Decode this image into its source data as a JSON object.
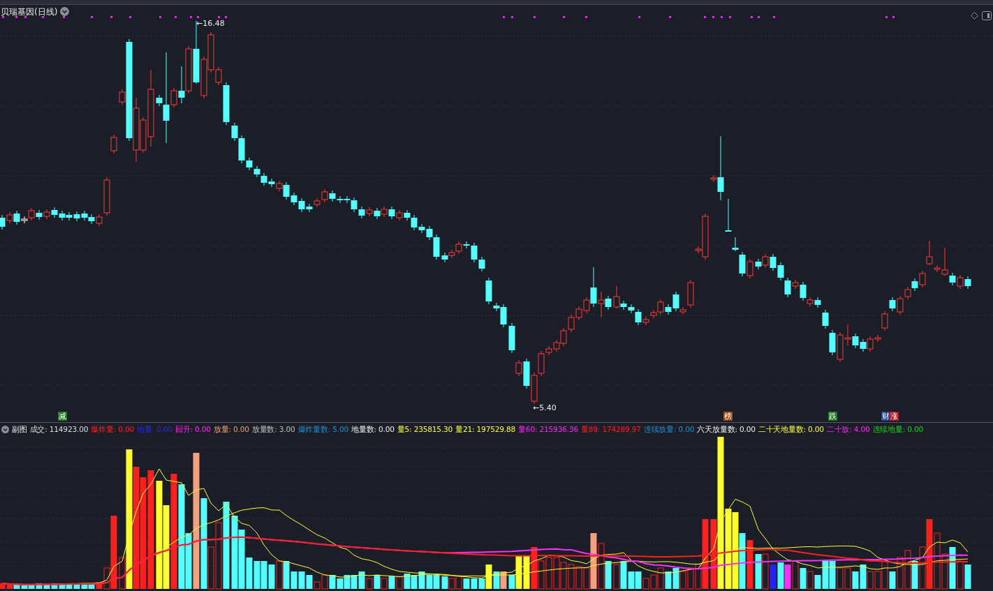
{
  "chart_title": "贝瑞基因(日线)",
  "price_labels": [
    {
      "kind": "high",
      "text": "←16.48"
    },
    {
      "kind": "low",
      "text": "←5.40"
    }
  ],
  "signals": [
    {
      "text": "减",
      "color": "#1d7a22"
    },
    {
      "text": "榜",
      "color": "#9a4e16"
    },
    {
      "text": "跌",
      "color": "#1d7a22"
    },
    {
      "text": "财",
      "color": "#24419c"
    },
    {
      "text": "涨",
      "color": "#b3161b"
    }
  ],
  "subchart": {
    "name": "副图",
    "legend": [
      {
        "text": "成交: 114923.00",
        "color": "#dcdcdc"
      },
      {
        "text": "爆炸量: 0.00",
        "color": "#ff2020"
      },
      {
        "text": "地量: 0.00",
        "color": "#2626ff"
      },
      {
        "text": "回升: 0.00",
        "color": "#ff26ff"
      },
      {
        "text": "放量: 0.00",
        "color": "#f0a070"
      },
      {
        "text": "放量数: 3.00",
        "color": "#c0c0c0"
      },
      {
        "text": "爆炸量数: 5.00",
        "color": "#1e8fd6"
      },
      {
        "text": "地量数: 0.00",
        "color": "#f0f0f0"
      },
      {
        "text": "量5: 235815.30",
        "color": "#ffff40"
      },
      {
        "text": "量21: 197529.88",
        "color": "#ffff40"
      },
      {
        "text": "量60: 215936.36",
        "color": "#ff26ff"
      },
      {
        "text": "量89: 174289.97",
        "color": "#ff2020"
      },
      {
        "text": "连续放量: 0.00",
        "color": "#1e8fd6"
      },
      {
        "text": "六天放量数: 0.00",
        "color": "#f0f0f0"
      },
      {
        "text": "二十天地量数: 0.00",
        "color": "#ffff40"
      },
      {
        "text": "二十放: 4.00",
        "color": "#ff26ff"
      },
      {
        "text": "连续地量: 0.00",
        "color": "#20d020"
      }
    ]
  }
}
